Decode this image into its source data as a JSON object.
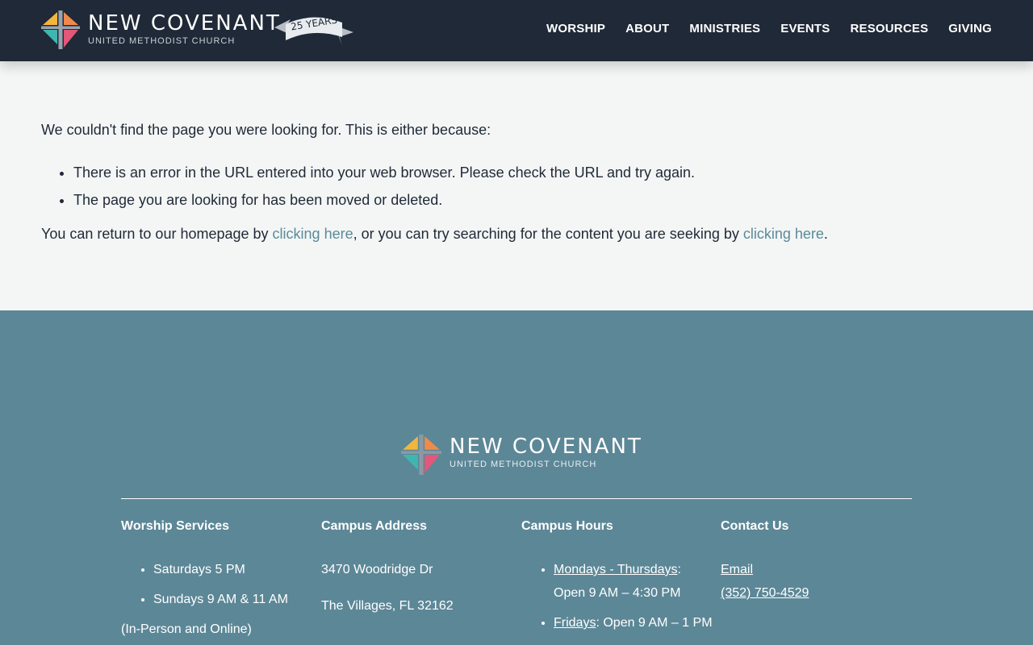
{
  "header": {
    "logo": {
      "title": "NEW COVENANT",
      "subtitle": "UNITED METHODIST CHURCH",
      "badge": "25 YEARS"
    },
    "nav": [
      "WORSHIP",
      "ABOUT",
      "MINISTRIES",
      "EVENTS",
      "RESOURCES",
      "GIVING"
    ]
  },
  "main": {
    "intro": "We couldn't find the page you were looking for. This is either because:",
    "reasons": [
      "There is an error in the URL entered into your web browser. Please check the URL and try again.",
      "The page you are looking for has been moved or deleted."
    ],
    "return_text_1": "You can return to our homepage by ",
    "link_1": "clicking here",
    "return_text_2": ", or you can try searching for the content you are seeking by ",
    "link_2": "clicking here",
    "return_text_3": "."
  },
  "footer": {
    "logo": {
      "title": "NEW COVENANT",
      "subtitle": "UNITED METHODIST CHURCH"
    },
    "columns": {
      "worship": {
        "title": "Worship Services",
        "items": [
          "Saturdays 5 PM",
          "Sundays 9 AM & 11 AM"
        ],
        "note": "(In-Person and Online)"
      },
      "address": {
        "title": "Campus Address",
        "street": "3470 Woodridge Dr",
        "city": "The Villages, FL 32162"
      },
      "hours": {
        "title": "Campus Hours",
        "items": [
          {
            "day": "Mondays - Thursdays",
            "hours": ": Open 9 AM – 4:30 PM"
          },
          {
            "day": "Fridays",
            "hours": ": Open 9 AM – 1 PM"
          }
        ]
      },
      "contact": {
        "title": "Contact Us",
        "email": "Email",
        "phone": "(352) 750-4529"
      }
    }
  },
  "colors": {
    "header_bg": "#1f2937",
    "page_bg": "#f4f6f5",
    "footer_bg": "#5c8797",
    "link": "#5b8a9a",
    "logo_yellow": "#f2b63d",
    "logo_teal": "#3fb7b0",
    "logo_pink": "#e2577a",
    "logo_orange": "#f08a4b"
  }
}
